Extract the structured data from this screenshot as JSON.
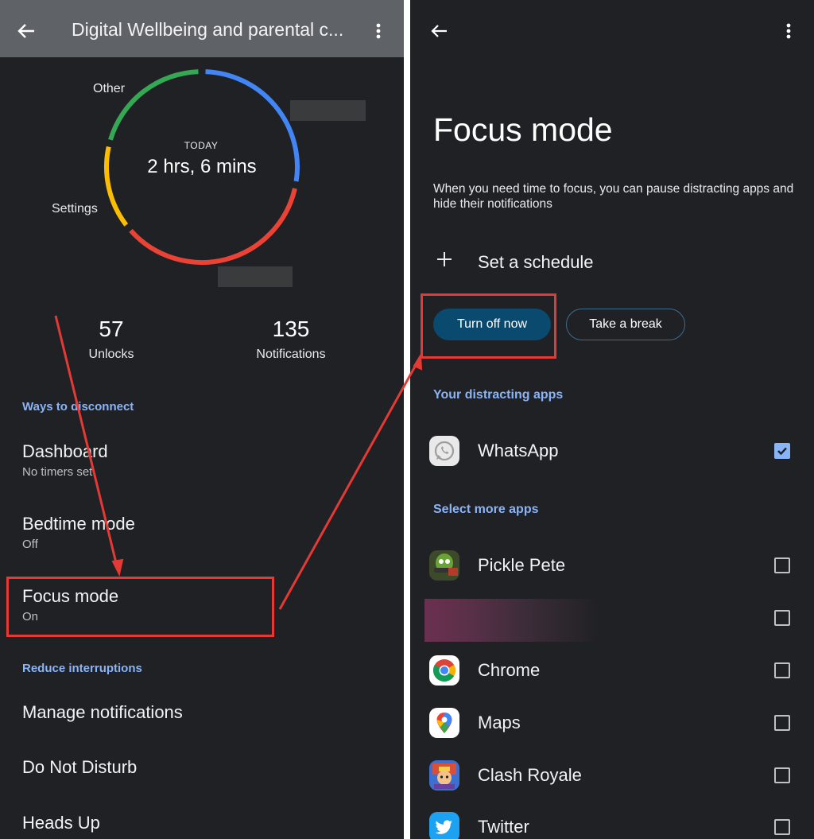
{
  "left": {
    "appbar": {
      "title": "Digital Wellbeing and parental c..."
    },
    "usage": {
      "today_label": "TODAY",
      "total": "2 hrs, 6 mins",
      "segments": [
        {
          "name": "Other",
          "color": "#34a853",
          "fraction": 0.21
        },
        {
          "name": "",
          "color": "#4285f4",
          "fraction": 0.28
        },
        {
          "name": "",
          "color": "#ea4335",
          "fraction": 0.36
        },
        {
          "name": "Settings",
          "color": "#fbbc04",
          "fraction": 0.15
        }
      ]
    },
    "stats": [
      {
        "value": "57",
        "label": "Unlocks"
      },
      {
        "value": "135",
        "label": "Notifications"
      }
    ],
    "sections": {
      "disconnect": "Ways to disconnect",
      "interruptions": "Reduce interruptions"
    },
    "items": {
      "dashboard": {
        "title": "Dashboard",
        "subtitle": "No timers set"
      },
      "bedtime": {
        "title": "Bedtime mode",
        "subtitle": "Off"
      },
      "focus": {
        "title": "Focus mode",
        "subtitle": "On"
      },
      "notifications": {
        "title": "Manage notifications"
      },
      "dnd": {
        "title": "Do Not Disturb"
      },
      "headsup": {
        "title": "Heads Up"
      }
    }
  },
  "right": {
    "title": "Focus mode",
    "description": "When you need time to focus, you can pause distracting apps and hide their notifications",
    "schedule_label": "Set a schedule",
    "turn_off_label": "Turn off now",
    "take_break_label": "Take a break",
    "distracting_header": "Your distracting apps",
    "more_header": "Select more apps",
    "distracting_apps": [
      {
        "name": "WhatsApp",
        "icon": "whatsapp-icon",
        "checked": true
      }
    ],
    "more_apps": [
      {
        "name": "Pickle Pete",
        "icon": "pickle-pete-icon",
        "checked": false
      },
      {
        "name": "",
        "icon": "blurred-app-icon",
        "checked": false
      },
      {
        "name": "Chrome",
        "icon": "chrome-icon",
        "checked": false
      },
      {
        "name": "Maps",
        "icon": "maps-icon",
        "checked": false
      },
      {
        "name": "Clash Royale",
        "icon": "clash-royale-icon",
        "checked": false
      },
      {
        "name": "Twitter",
        "icon": "twitter-icon",
        "checked": false
      }
    ]
  },
  "annotation_color": "#e53935"
}
